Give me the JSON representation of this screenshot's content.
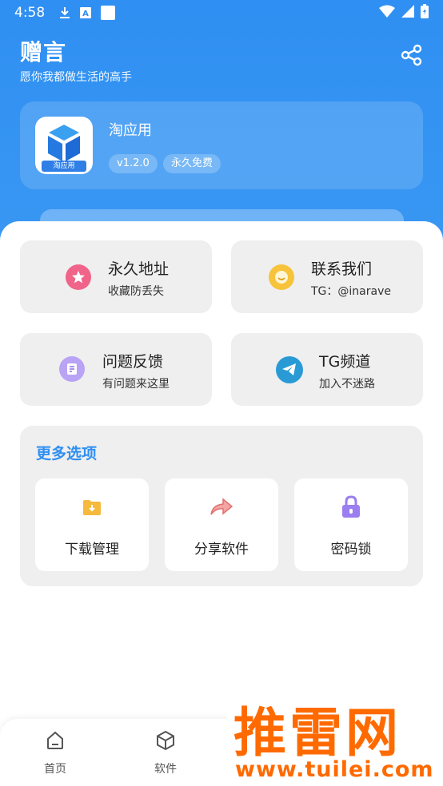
{
  "status_bar": {
    "time": "4:58",
    "icons": [
      "download-icon",
      "a-icon",
      "square-icon",
      "wifi-icon",
      "signal-icon",
      "battery-icon"
    ]
  },
  "header": {
    "title": "赠言",
    "subtitle": "愿你我都做生活的高手",
    "share_icon": "share-icon"
  },
  "app_card": {
    "name": "淘应用",
    "logo_label": "淘应用",
    "version": "v1.2.0",
    "free_badge": "永久免费"
  },
  "tiles": [
    {
      "title": "永久地址",
      "subtitle": "收藏防丢失",
      "icon": "star-icon",
      "color": "#f0648a"
    },
    {
      "title": "联系我们",
      "subtitle": "TG：@inarave",
      "icon": "chat-icon",
      "color": "#f6c33a"
    },
    {
      "title": "问题反馈",
      "subtitle": "有问题来这里",
      "icon": "feedback-icon",
      "color": "#9b7ef0"
    },
    {
      "title": "TG频道",
      "subtitle": "加入不迷路",
      "icon": "telegram-icon",
      "color": "#2a9ad6"
    }
  ],
  "more": {
    "title": "更多选项",
    "options": [
      {
        "label": "下载管理",
        "icon": "folder-download-icon"
      },
      {
        "label": "分享软件",
        "icon": "share-arrow-icon"
      },
      {
        "label": "密码锁",
        "icon": "lock-icon"
      }
    ]
  },
  "bottom_nav": [
    {
      "label": "首页",
      "icon": "home-icon"
    },
    {
      "label": "软件",
      "icon": "cube-icon"
    }
  ],
  "watermark": {
    "brand": "推雷网",
    "url": "www.tuilei.com"
  },
  "colors": {
    "primary": "#2f8ff2",
    "watermark": "#ff6a00"
  }
}
